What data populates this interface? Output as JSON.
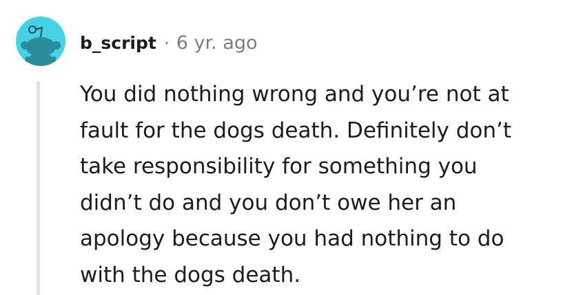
{
  "comment": {
    "author": {
      "username": "b_script",
      "avatar_icon": "reddit-snoo-icon",
      "avatar_color": "#46d1e6"
    },
    "separator": "·",
    "timestamp": "6 yr. ago",
    "body_lines": [
      "You did nothing wrong and you’re not at",
      "fault for the dogs death. Definitely don’t",
      "take responsibility for something you",
      "didn’t do and you don’t owe her an",
      "apology because you had nothing to do",
      "with the dogs death."
    ]
  }
}
